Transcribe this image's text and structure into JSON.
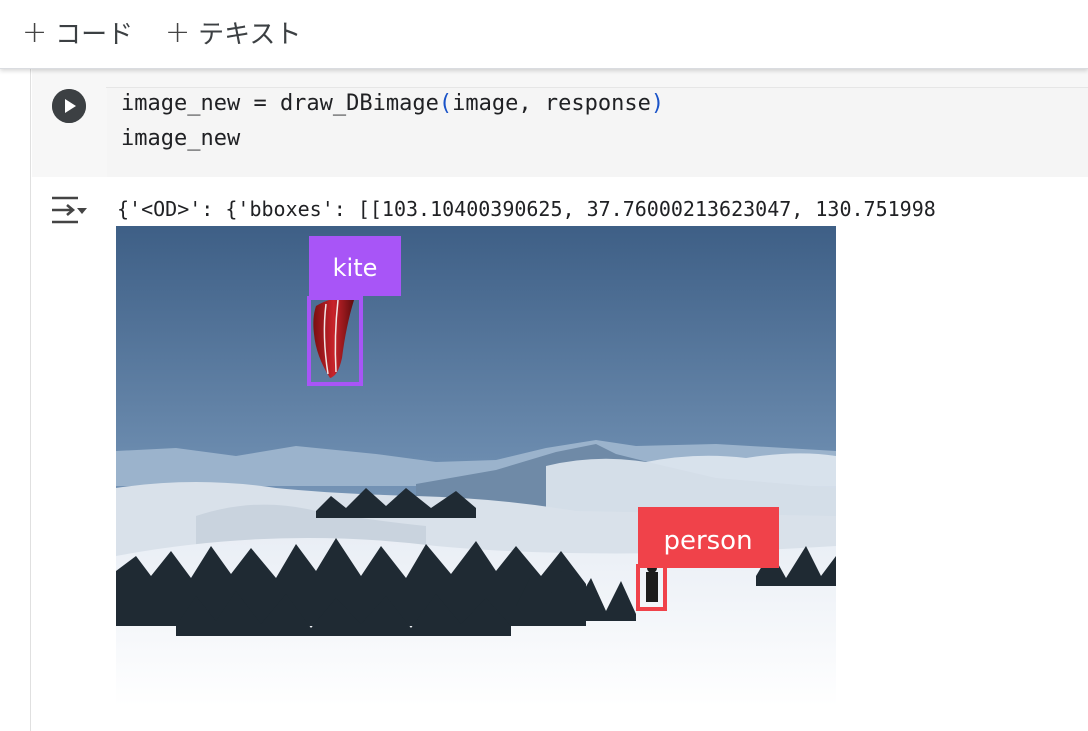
{
  "toolbar": {
    "add_code_label": "コード",
    "add_text_label": "テキスト",
    "plus_symbol": "+"
  },
  "code_cell": {
    "line1_prefix": "image_new = draw_DBimage",
    "line1_paren_open": "(",
    "line1_args": "image, response",
    "line1_paren_close": ")",
    "line2": "image_new",
    "run_icon": "play-circle-icon"
  },
  "output": {
    "icon": "output-toggle-icon",
    "text": "{'<OD>': {'bboxes': [[103.10400390625, 37.76000213623047, 130.751998",
    "detections": [
      {
        "label": "kite",
        "color": "#a855f7"
      },
      {
        "label": "person",
        "color": "#f0424a"
      }
    ]
  },
  "colors": {
    "run_button": "#3c4043",
    "code_background": "#f7f7f7",
    "paren": "#1a53c8"
  }
}
